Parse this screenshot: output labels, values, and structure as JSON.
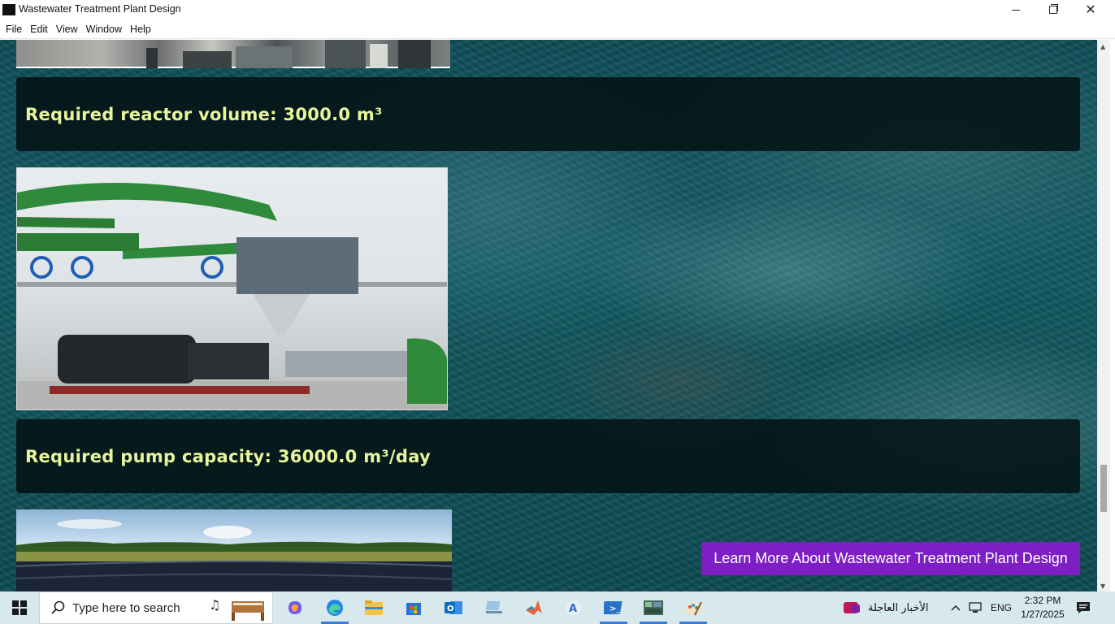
{
  "window": {
    "title": "Wastewater Treatment Plant Design",
    "minimize_icon": "minimize-icon",
    "maximize_icon": "restore-icon",
    "close_icon": "close-icon"
  },
  "menu": [
    "File",
    "Edit",
    "View",
    "Window",
    "Help"
  ],
  "results": {
    "reactor": "Required reactor volume: 3000.0 m³",
    "pump": "Required pump capacity: 36000.0 m³/day"
  },
  "cta": {
    "label": "Learn More About Wastewater Treatment Plant Design"
  },
  "colors": {
    "result_text": "#e8f59a",
    "cta_bg": "#7d1fc5",
    "background": "#135a63"
  },
  "taskbar": {
    "search_placeholder": "Type here to search",
    "news": "الأخبار العاجلة",
    "language": "ENG",
    "time": "2:32 PM",
    "date": "1/27/2025"
  }
}
